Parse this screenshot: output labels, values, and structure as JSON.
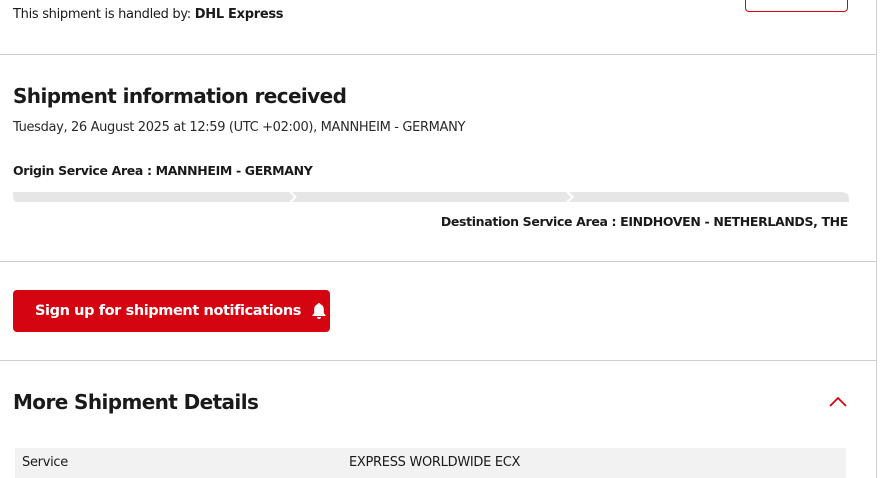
{
  "carrier": {
    "label": "This shipment is handled by:",
    "name": "DHL Express"
  },
  "status": {
    "title": "Shipment information received",
    "timestamp": "Tuesday, 26 August 2025 at 12:59 (UTC +02:00), MANNHEIM - GERMANY",
    "origin_label": "Origin Service Area : MANNHEIM - GERMANY",
    "destination_label": "Destination Service Area : EINDHOVEN - NETHERLANDS, THE",
    "progress_segments": 3,
    "progress_completed": 0
  },
  "notifications": {
    "button_label": "Sign up for shipment notifications",
    "icon": "bell-icon"
  },
  "details": {
    "title": "More Shipment Details",
    "toggle_icon": "chevron-up-icon",
    "rows": [
      {
        "key": "Service",
        "value": "EXPRESS WORLDWIDE ECX"
      }
    ]
  },
  "colors": {
    "accent": "#d40511",
    "progress_track": "#e6e6e6",
    "row_background": "#f2f2f2",
    "divider": "#cfcfcf"
  }
}
